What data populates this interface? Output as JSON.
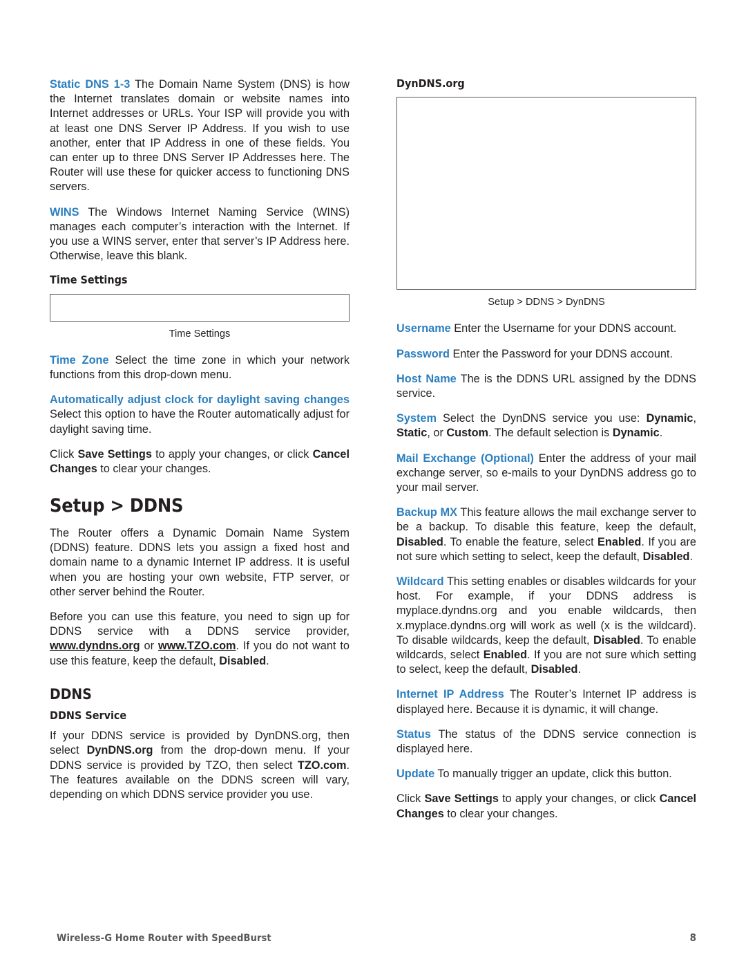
{
  "document": {
    "footer_title": "Wireless-G Home Router with SpeedBurst",
    "page_number": "8",
    "accent_color": "#2b7fc0",
    "text_color": "#231f20",
    "footer_color": "#58585a",
    "figure_border_color": "#58585a"
  },
  "left_column": {
    "paragraphs": {
      "static_dns": {
        "term": "Static DNS 1-3",
        "text": " The Domain Name System (DNS) is how the Internet translates domain or website names into Internet addresses or URLs. Your ISP will provide you with at least one DNS Server IP Address. If you wish to use another, enter that IP Address in one of these fields. You can enter up to three DNS Server IP Addresses here. The Router will use these for quicker access to functioning DNS servers."
      },
      "wins": {
        "term": "WINS",
        "text": " The Windows Internet Naming Service (WINS) manages each computer’s interaction with the Internet. If you use a WINS server, enter that server’s IP Address here. Otherwise, leave this blank."
      },
      "time_zone": {
        "term": "Time Zone",
        "text": " Select the time zone in which your network functions from this drop-down menu."
      },
      "auto_dst": {
        "term": "Automatically adjust clock for daylight saving changes",
        "text": " Select this option to have the Router automatically adjust for daylight saving time."
      },
      "save_cancel": {
        "pre": "Click ",
        "bold1": "Save Settings",
        "mid": " to apply your changes, or click ",
        "bold2": "Cancel Changes",
        "post": " to clear your changes."
      },
      "ddns_intro": "The Router offers a Dynamic Domain Name System (DDNS) feature. DDNS lets you assign a fixed host and domain name to a dynamic Internet IP address. It is useful when you are hosting your own website, FTP server, or other server behind the Router.",
      "ddns_signup": {
        "pre": "Before you can use this feature, you need to sign up for DDNS service with a DDNS service provider, ",
        "link1": "www.dyndns.org",
        "mid": " or ",
        "link2": "www.TZO.com",
        "post2": ". If you do not want to use this feature, keep the default, ",
        "bold": "Disabled",
        "end": "."
      },
      "ddns_service_body": {
        "pre": "If your DDNS service is provided by DynDNS.org, then select ",
        "bold1": "DynDNS.org",
        "mid": " from the drop-down menu. If your DDNS service is provided by TZO, then select ",
        "bold2": "TZO.com",
        "mid2": ". The features available on the DDNS screen will vary, depending on which DDNS service provider you use."
      }
    },
    "headings": {
      "time_settings": "Time Settings",
      "setup_ddns": "Setup > DDNS",
      "ddns": "DDNS",
      "ddns_service": "DDNS Service"
    },
    "figures": {
      "time_settings_caption": "Time Settings"
    }
  },
  "right_column": {
    "headings": {
      "dyndns_org": "DynDNS.org"
    },
    "figures": {
      "dyndns_caption": "Setup > DDNS > DynDNS"
    },
    "paragraphs": {
      "username": {
        "term": "Username",
        "text": "  Enter the Username for your DDNS account."
      },
      "password": {
        "term": "Password",
        "text": "  Enter the Password for your DDNS account."
      },
      "host_name": {
        "term": "Host Name",
        "text": "  The is the DDNS URL assigned by the DDNS service."
      },
      "system": {
        "term": "System",
        "pre": " Select the DynDNS service you use: ",
        "bold1": "Dynamic",
        "mid1": ", ",
        "bold2": "Static",
        "mid2": ", or ",
        "bold3": "Custom",
        "mid3": ". The default selection is ",
        "bold4": "Dynamic",
        "end": "."
      },
      "mail_exchange": {
        "term": "Mail Exchange (Optional)",
        "text": "  Enter the address of your mail exchange server, so e-mails to your DynDNS address go to your mail server."
      },
      "backup_mx": {
        "term": "Backup MX",
        "pre": "  This feature allows the mail exchange server to be a backup. To disable this feature, keep the default, ",
        "bold1": "Disabled",
        "mid1": ". To enable the feature, select ",
        "bold2": "Enabled",
        "mid2": ". If you are not sure which setting to select, keep the default, ",
        "bold3": "Disabled",
        "end": "."
      },
      "wildcard": {
        "term": "Wildcard",
        "pre": " This setting enables or disables wildcards for your host. For example, if your DDNS address is myplace.dyndns.org and you enable wildcards, then x.myplace.dyndns.org will work as well (x is the wildcard). To disable wildcards, keep the default, ",
        "bold1": "Disabled",
        "mid1": ". To enable wildcards, select ",
        "bold2": "Enabled",
        "mid2": ". If you are not sure which setting to select, keep the default, ",
        "bold3": "Disabled",
        "end": "."
      },
      "internet_ip": {
        "term": "Internet IP Address",
        "text": "  The Router’s Internet IP address is displayed here. Because it is dynamic, it will change."
      },
      "status": {
        "term": "Status",
        "text": " The status of the DDNS service connection is displayed here."
      },
      "update": {
        "term": "Update",
        "text": "  To manually trigger an update, click this button."
      },
      "save_cancel": {
        "pre": "Click ",
        "bold1": "Save Settings",
        "mid": " to apply your changes, or click ",
        "bold2": "Cancel Changes",
        "post": " to clear your changes."
      }
    }
  }
}
